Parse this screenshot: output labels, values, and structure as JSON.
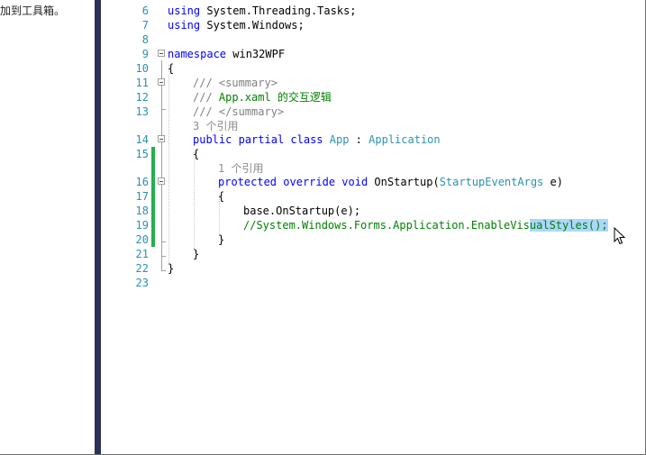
{
  "toolbox": {
    "hint": "加到工具箱。"
  },
  "editor": {
    "lines": [
      {
        "num": "6",
        "text": "using System.Threading.Tasks;"
      },
      {
        "num": "7",
        "text": "using System.Windows;"
      },
      {
        "num": "8",
        "text": ""
      },
      {
        "num": "9",
        "text": "namespace win32WPF"
      },
      {
        "num": "10",
        "text": "{"
      },
      {
        "num": "11",
        "text": "/// <summary>"
      },
      {
        "num": "12",
        "text": "/// App.xaml 的交互逻辑"
      },
      {
        "num": "13",
        "text": "/// </summary>"
      },
      {
        "num": "",
        "text": "3 个引用"
      },
      {
        "num": "14",
        "text": "public partial class App : Application"
      },
      {
        "num": "15",
        "text": "{"
      },
      {
        "num": "",
        "text": "1 个引用"
      },
      {
        "num": "16",
        "text": "protected override void OnStartup(StartupEventArgs e)"
      },
      {
        "num": "17",
        "text": "{"
      },
      {
        "num": "18",
        "text": "base.OnStartup(e);"
      },
      {
        "num": "19",
        "text": "//System.Windows.Forms.Application.EnableVisualStyles();"
      },
      {
        "num": "20",
        "text": "}"
      },
      {
        "num": "21",
        "text": "}"
      },
      {
        "num": "22",
        "text": "}"
      },
      {
        "num": "23",
        "text": ""
      }
    ],
    "tokens": {
      "using": "using",
      "threading": " System.Threading.Tasks;",
      "windows": " System.Windows;",
      "namespace": "namespace",
      "ns_name": " win32WPF",
      "doc_slash": "/// ",
      "summary_open": "<summary>",
      "summary_close": "</summary>",
      "doc_text": "App.xaml 的交互逻辑",
      "public": "public",
      "partial": "partial",
      "class": "class",
      "app": "App",
      "colon": " : ",
      "application": "Application",
      "protected": "protected",
      "override": "override",
      "void": "void",
      "onstartup": " OnStartup(",
      "sea": "StartupEventArgs",
      "e_param": " e)",
      "base_call": "base.OnStartup(e);",
      "comment_pre": "//System.Windows.Forms.Application.EnableVis",
      "comment_sel": "ualStyles();"
    }
  },
  "colors": {
    "keyword": "#0000ff",
    "comment": "#008000",
    "type": "#2b91af",
    "doc_tag": "#808080",
    "changed_marker": "#22b14c",
    "selection": "#add6ff",
    "splitter": "#2d3158"
  },
  "icons": {
    "cursor": "arrow-cursor-icon"
  }
}
